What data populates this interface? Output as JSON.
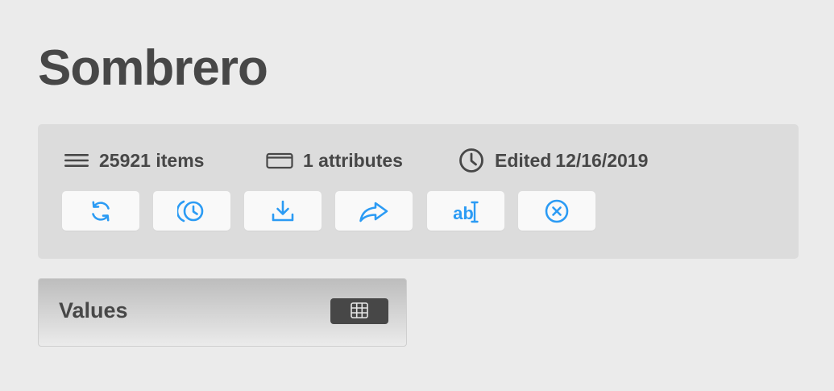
{
  "page": {
    "title": "Sombrero"
  },
  "stats": {
    "items": {
      "icon": "menu-lines-icon",
      "text": "25921 items"
    },
    "attributes": {
      "icon": "card-icon",
      "text": "1 attributes"
    },
    "edited": {
      "icon": "clock-icon",
      "label": "Edited",
      "date": "12/16/2019"
    }
  },
  "toolbar": {
    "accent_color": "#2b9bf4",
    "buttons": [
      {
        "icon": "refresh-icon"
      },
      {
        "icon": "history-icon"
      },
      {
        "icon": "download-icon"
      },
      {
        "icon": "share-icon"
      },
      {
        "icon": "rename-text-icon",
        "glyph": "ab"
      },
      {
        "icon": "close-circle-icon"
      }
    ]
  },
  "values_panel": {
    "title": "Values",
    "toggle_icon": "grid-icon"
  }
}
